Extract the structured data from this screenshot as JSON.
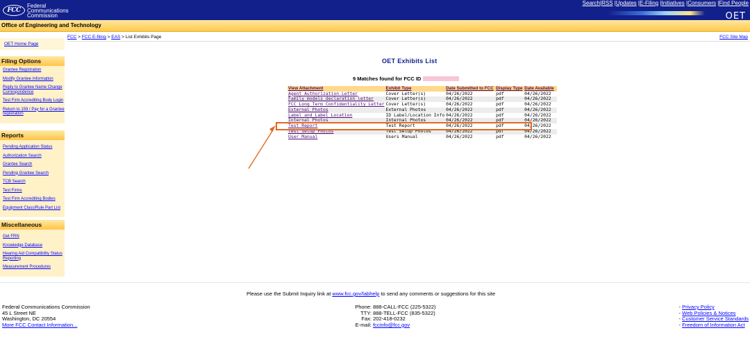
{
  "header": {
    "logo_badge": "FCC",
    "logo_lines": [
      "Federal",
      "Communications",
      "Commission"
    ],
    "top_links": [
      "Search",
      "RSS",
      "Updates",
      "E-Filing",
      "Initiatives",
      "Consumers",
      "Find People"
    ],
    "brand": "OET"
  },
  "office_bar": "Office of Engineering and Technology",
  "breadcrumb": {
    "links": [
      "FCC",
      "FCC E-filing",
      "EAS"
    ],
    "current": "List Exhibits Page",
    "site_map": "FCC Site Map"
  },
  "sidebar": {
    "home_link": "OET Home Page",
    "sections": [
      {
        "title": "Filing Options",
        "items": [
          "Grantee Registration",
          "Modify Grantee Information",
          "Reply to Grantee Name Change Correspondence",
          "Test Firm Accrediting Body Login",
          "Return to 159 / Pay for a Grantee registration"
        ]
      },
      {
        "title": "Reports",
        "items": [
          "Pending Application Status",
          "Authorization Search",
          "Grantee Search",
          "Pending Grantee Search",
          "TCB Search",
          "Test Firms",
          "Test Firm Accrediting Bodies",
          "Equipment Class/Rule Part List"
        ]
      },
      {
        "title": "Miscellaneous",
        "items": [
          "Get FRN",
          "Knowledge Database",
          "Hearing Aid Compatibility Status Reporting",
          "Measurement Procedures"
        ]
      }
    ]
  },
  "main": {
    "title": "OET Exhibits List",
    "matches_text": "9 Matches found for FCC ID",
    "columns": [
      "View Attachment",
      "Exhibit Type",
      "Date Submitted to FCC",
      "Display Type",
      "Date Available"
    ],
    "rows": [
      [
        "Agent Authorization Letter",
        "Cover Letter(s)",
        "04/26/2022",
        "pdf",
        "04/26/2022"
      ],
      [
        "Family models declaration letter",
        "Cover Letter(s)",
        "04/26/2022",
        "pdf",
        "04/26/2022"
      ],
      [
        "FCC Long Term Confidentiality Letter",
        "Cover Letter(s)",
        "04/26/2022",
        "pdf",
        "04/26/2022"
      ],
      [
        "External Photos",
        "External Photos",
        "04/26/2022",
        "pdf",
        "04/26/2022"
      ],
      [
        "Label and Label Location",
        "ID Label/Location Info",
        "04/26/2022",
        "pdf",
        "04/26/2022"
      ],
      [
        "Internal Photos",
        "Internal Photos",
        "04/26/2022",
        "pdf",
        "04/26/2022"
      ],
      [
        "Test Report",
        "Test Report",
        "04/26/2022",
        "pdf",
        "04/26/2022"
      ],
      [
        "Test Setup Photos",
        "Test Setup Photos",
        "04/26/2022",
        "pdf",
        "04/26/2022"
      ],
      [
        "User Manual",
        "Users Manual",
        "04/26/2022",
        "pdf",
        "04/26/2022"
      ]
    ],
    "highlighted_row": "Test Report",
    "highlight_color": "#e4661e"
  },
  "footer": {
    "inquiry_prefix": "Please use the Submit Inquiry link at",
    "inquiry_link": "www.fcc.gov/labhelp",
    "inquiry_suffix": "to send any comments or suggestions for this site",
    "address": [
      "Federal Communications Commission",
      "45 L Street NE",
      "Washington, DC 20554"
    ],
    "address_link": "More FCC Contact Information...",
    "contact": [
      {
        "label": "Phone:",
        "value": "888-CALL-FCC (225-5322)"
      },
      {
        "label": "TTY:",
        "value": "888-TELL-FCC (835-5322)"
      },
      {
        "label": "Fax:",
        "value": "202-418-0232"
      },
      {
        "label": "E-mail:",
        "value": "fccinfo@fcc.gov"
      }
    ],
    "policy_links": [
      "Privacy Policy",
      "Web Policies & Notices",
      "Customer Service Standards",
      "Freedom of Information Act"
    ]
  }
}
